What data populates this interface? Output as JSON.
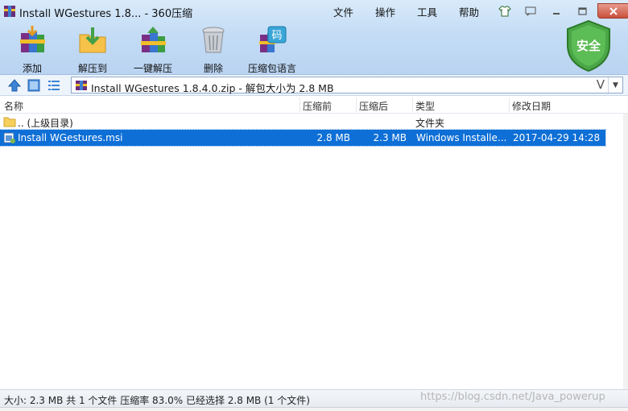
{
  "window": {
    "title": "Install WGestures 1.8... - 360压缩",
    "menu": [
      "文件",
      "操作",
      "工具",
      "帮助"
    ]
  },
  "toolbar": {
    "items": [
      {
        "label": "添加",
        "icon": "add-books-icon"
      },
      {
        "label": "解压到",
        "icon": "extract-to-icon"
      },
      {
        "label": "一键解压",
        "icon": "one-click-extract-icon"
      },
      {
        "label": "删除",
        "icon": "trash-can-icon"
      },
      {
        "label": "压缩包语言",
        "icon": "archive-language-icon"
      }
    ],
    "security_badge": "安全"
  },
  "address": {
    "path": "Install WGestures 1.8.4.0.zip - 解包大小为 2.8 MB",
    "v_button": "V"
  },
  "columns": {
    "name": "名称",
    "compressed_before": "压缩前",
    "compressed_after": "压缩后",
    "type": "类型",
    "modified": "修改日期"
  },
  "files": [
    {
      "name": ".. (上级目录)",
      "before": "",
      "after": "",
      "type": "文件夹",
      "modified": "",
      "icon": "folder-icon"
    },
    {
      "name": "Install WGestures.msi",
      "before": "2.8 MB",
      "after": "2.3 MB",
      "type": "Windows Installe...",
      "modified": "2017-04-29 14:28",
      "icon": "msi-installer-icon"
    }
  ],
  "status": {
    "text": "大小: 2.3 MB 共 1 个文件 压缩率 83.0% 已经选择 2.8 MB (1 个文件)"
  },
  "watermark": "https://blog.csdn.net/Java_powerup",
  "colors": {
    "selection": "#0e6fd6",
    "toolbar_bg": "#c4dcf5",
    "shield_green": "#3f9a3a"
  }
}
